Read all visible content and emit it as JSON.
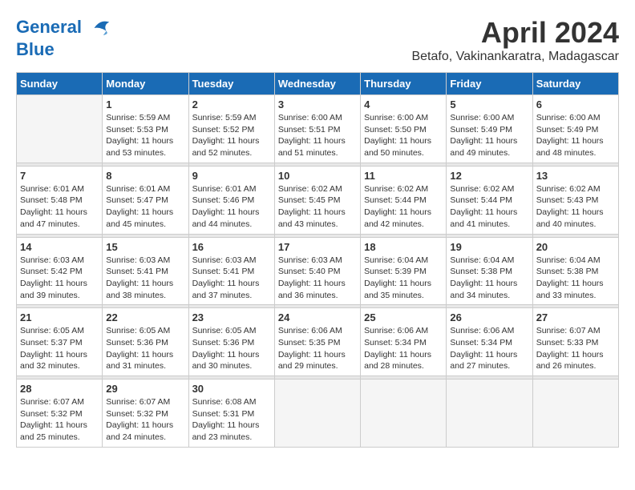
{
  "logo": {
    "line1": "General",
    "line2": "Blue"
  },
  "title": "April 2024",
  "subtitle": "Betafo, Vakinankaratra, Madagascar",
  "days_of_week": [
    "Sunday",
    "Monday",
    "Tuesday",
    "Wednesday",
    "Thursday",
    "Friday",
    "Saturday"
  ],
  "weeks": [
    [
      {
        "day": "",
        "sunrise": "",
        "sunset": "",
        "daylight": ""
      },
      {
        "day": "1",
        "sunrise": "Sunrise: 5:59 AM",
        "sunset": "Sunset: 5:53 PM",
        "daylight": "Daylight: 11 hours and 53 minutes."
      },
      {
        "day": "2",
        "sunrise": "Sunrise: 5:59 AM",
        "sunset": "Sunset: 5:52 PM",
        "daylight": "Daylight: 11 hours and 52 minutes."
      },
      {
        "day": "3",
        "sunrise": "Sunrise: 6:00 AM",
        "sunset": "Sunset: 5:51 PM",
        "daylight": "Daylight: 11 hours and 51 minutes."
      },
      {
        "day": "4",
        "sunrise": "Sunrise: 6:00 AM",
        "sunset": "Sunset: 5:50 PM",
        "daylight": "Daylight: 11 hours and 50 minutes."
      },
      {
        "day": "5",
        "sunrise": "Sunrise: 6:00 AM",
        "sunset": "Sunset: 5:49 PM",
        "daylight": "Daylight: 11 hours and 49 minutes."
      },
      {
        "day": "6",
        "sunrise": "Sunrise: 6:00 AM",
        "sunset": "Sunset: 5:49 PM",
        "daylight": "Daylight: 11 hours and 48 minutes."
      }
    ],
    [
      {
        "day": "7",
        "sunrise": "Sunrise: 6:01 AM",
        "sunset": "Sunset: 5:48 PM",
        "daylight": "Daylight: 11 hours and 47 minutes."
      },
      {
        "day": "8",
        "sunrise": "Sunrise: 6:01 AM",
        "sunset": "Sunset: 5:47 PM",
        "daylight": "Daylight: 11 hours and 45 minutes."
      },
      {
        "day": "9",
        "sunrise": "Sunrise: 6:01 AM",
        "sunset": "Sunset: 5:46 PM",
        "daylight": "Daylight: 11 hours and 44 minutes."
      },
      {
        "day": "10",
        "sunrise": "Sunrise: 6:02 AM",
        "sunset": "Sunset: 5:45 PM",
        "daylight": "Daylight: 11 hours and 43 minutes."
      },
      {
        "day": "11",
        "sunrise": "Sunrise: 6:02 AM",
        "sunset": "Sunset: 5:44 PM",
        "daylight": "Daylight: 11 hours and 42 minutes."
      },
      {
        "day": "12",
        "sunrise": "Sunrise: 6:02 AM",
        "sunset": "Sunset: 5:44 PM",
        "daylight": "Daylight: 11 hours and 41 minutes."
      },
      {
        "day": "13",
        "sunrise": "Sunrise: 6:02 AM",
        "sunset": "Sunset: 5:43 PM",
        "daylight": "Daylight: 11 hours and 40 minutes."
      }
    ],
    [
      {
        "day": "14",
        "sunrise": "Sunrise: 6:03 AM",
        "sunset": "Sunset: 5:42 PM",
        "daylight": "Daylight: 11 hours and 39 minutes."
      },
      {
        "day": "15",
        "sunrise": "Sunrise: 6:03 AM",
        "sunset": "Sunset: 5:41 PM",
        "daylight": "Daylight: 11 hours and 38 minutes."
      },
      {
        "day": "16",
        "sunrise": "Sunrise: 6:03 AM",
        "sunset": "Sunset: 5:41 PM",
        "daylight": "Daylight: 11 hours and 37 minutes."
      },
      {
        "day": "17",
        "sunrise": "Sunrise: 6:03 AM",
        "sunset": "Sunset: 5:40 PM",
        "daylight": "Daylight: 11 hours and 36 minutes."
      },
      {
        "day": "18",
        "sunrise": "Sunrise: 6:04 AM",
        "sunset": "Sunset: 5:39 PM",
        "daylight": "Daylight: 11 hours and 35 minutes."
      },
      {
        "day": "19",
        "sunrise": "Sunrise: 6:04 AM",
        "sunset": "Sunset: 5:38 PM",
        "daylight": "Daylight: 11 hours and 34 minutes."
      },
      {
        "day": "20",
        "sunrise": "Sunrise: 6:04 AM",
        "sunset": "Sunset: 5:38 PM",
        "daylight": "Daylight: 11 hours and 33 minutes."
      }
    ],
    [
      {
        "day": "21",
        "sunrise": "Sunrise: 6:05 AM",
        "sunset": "Sunset: 5:37 PM",
        "daylight": "Daylight: 11 hours and 32 minutes."
      },
      {
        "day": "22",
        "sunrise": "Sunrise: 6:05 AM",
        "sunset": "Sunset: 5:36 PM",
        "daylight": "Daylight: 11 hours and 31 minutes."
      },
      {
        "day": "23",
        "sunrise": "Sunrise: 6:05 AM",
        "sunset": "Sunset: 5:36 PM",
        "daylight": "Daylight: 11 hours and 30 minutes."
      },
      {
        "day": "24",
        "sunrise": "Sunrise: 6:06 AM",
        "sunset": "Sunset: 5:35 PM",
        "daylight": "Daylight: 11 hours and 29 minutes."
      },
      {
        "day": "25",
        "sunrise": "Sunrise: 6:06 AM",
        "sunset": "Sunset: 5:34 PM",
        "daylight": "Daylight: 11 hours and 28 minutes."
      },
      {
        "day": "26",
        "sunrise": "Sunrise: 6:06 AM",
        "sunset": "Sunset: 5:34 PM",
        "daylight": "Daylight: 11 hours and 27 minutes."
      },
      {
        "day": "27",
        "sunrise": "Sunrise: 6:07 AM",
        "sunset": "Sunset: 5:33 PM",
        "daylight": "Daylight: 11 hours and 26 minutes."
      }
    ],
    [
      {
        "day": "28",
        "sunrise": "Sunrise: 6:07 AM",
        "sunset": "Sunset: 5:32 PM",
        "daylight": "Daylight: 11 hours and 25 minutes."
      },
      {
        "day": "29",
        "sunrise": "Sunrise: 6:07 AM",
        "sunset": "Sunset: 5:32 PM",
        "daylight": "Daylight: 11 hours and 24 minutes."
      },
      {
        "day": "30",
        "sunrise": "Sunrise: 6:08 AM",
        "sunset": "Sunset: 5:31 PM",
        "daylight": "Daylight: 11 hours and 23 minutes."
      },
      {
        "day": "",
        "sunrise": "",
        "sunset": "",
        "daylight": ""
      },
      {
        "day": "",
        "sunrise": "",
        "sunset": "",
        "daylight": ""
      },
      {
        "day": "",
        "sunrise": "",
        "sunset": "",
        "daylight": ""
      },
      {
        "day": "",
        "sunrise": "",
        "sunset": "",
        "daylight": ""
      }
    ]
  ]
}
